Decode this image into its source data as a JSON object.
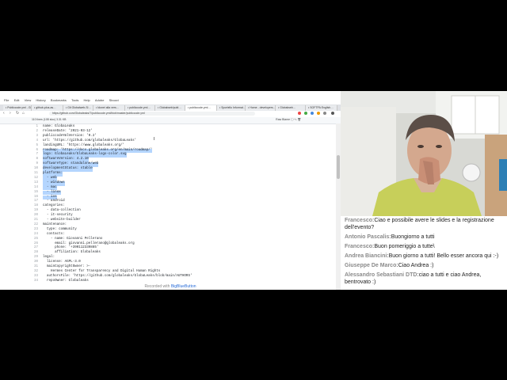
{
  "browser": {
    "menu": [
      "File",
      "Edit",
      "View",
      "History",
      "Bookmarks",
      "Tools",
      "Help",
      "Adobe",
      "Sbozzi"
    ],
    "tabs": [
      {
        "label": "• Publiccode.yml - Gi…",
        "active": false
      },
      {
        "label": "• github-plus-as…",
        "active": false
      },
      {
        "label": "• Git Globalweb-Si…",
        "active": false
      },
      {
        "label": "• Idonei alla vers…",
        "active": false
      },
      {
        "label": "• publiccode.yml…",
        "active": false
      },
      {
        "label": "• Globalweb/publ…",
        "active": false
      },
      {
        "label": "• publiccode.yml…",
        "active": true
      },
      {
        "label": "• Sportello Informat…",
        "active": false
      },
      {
        "label": "• Home - developers…",
        "active": false
      },
      {
        "label": "• Globalweb…",
        "active": false
      },
      {
        "label": "• SOFTPA English…",
        "active": false
      }
    ],
    "url": "https://github.com/GlobaleaksIT/publiccode.yml/blob/master/publiccode.yml",
    "file_info": "110 lines (108 sloc)   3.31 KB",
    "file_buttons": "Raw   Blame   🖵   ✎   🗑"
  },
  "code": [
    {
      "n": "1",
      "t": "name: GlobaLeaks"
    },
    {
      "n": "2",
      "t": "releaseDate: '2021-03-12'"
    },
    {
      "n": "3",
      "t": "publiccodeYmlVersion: '0.2'"
    },
    {
      "n": "4",
      "t": "url: 'https://github.com/globaleaks/GlobaLeaks'"
    },
    {
      "n": "5",
      "t": "landingURL: 'https://www.globaleaks.org/'"
    },
    {
      "n": "6",
      "t": "roadmap: 'https://docs.globaleaks.org/en/main/roadmap/'",
      "hl": true
    },
    {
      "n": "7",
      "t": "logo: GlobaLeaks/GlobaLeaks-logo-color.svg",
      "hl": true
    },
    {
      "n": "8",
      "t": "softwareVersion: 4.2.10",
      "hl": true
    },
    {
      "n": "9",
      "t": "softwareType: standalone/web",
      "hl": true
    },
    {
      "n": "10",
      "t": "developmentStatus: stable",
      "hl": true
    },
    {
      "n": "11",
      "t": "platforms:",
      "hl": true
    },
    {
      "n": "12",
      "t": "  - web",
      "hl": true
    },
    {
      "n": "13",
      "t": "  - windows",
      "hl": true
    },
    {
      "n": "14",
      "t": "  - mac",
      "hl": true
    },
    {
      "n": "15",
      "t": "  - linux",
      "hl": true
    },
    {
      "n": "16",
      "t": "  - ios",
      "hl": true
    },
    {
      "n": "17",
      "t": "  - android"
    },
    {
      "n": "18",
      "t": "categories:"
    },
    {
      "n": "19",
      "t": "  - data-collection"
    },
    {
      "n": "20",
      "t": "  - it-security"
    },
    {
      "n": "21",
      "t": "  - website-builder"
    },
    {
      "n": "22",
      "t": "maintenance:"
    },
    {
      "n": "23",
      "t": "  type: community"
    },
    {
      "n": "24",
      "t": "  contacts:"
    },
    {
      "n": "25",
      "t": "    - name: Giovanni Pellerano"
    },
    {
      "n": "26",
      "t": "      email: giovanni.pellerano@globaleaks.org"
    },
    {
      "n": "27",
      "t": "      phone: '+390112339885'"
    },
    {
      "n": "28",
      "t": "      affiliation: Globaleaks"
    },
    {
      "n": "29",
      "t": "legal:"
    },
    {
      "n": "30",
      "t": "  license: AGPL-3.0"
    },
    {
      "n": "31",
      "t": "  mainCopyrightOwner: >-"
    },
    {
      "n": "32",
      "t": "    Hermes Center for Transparency and Digital Human Rights"
    },
    {
      "n": "33",
      "t": "  authorsFile: 'https://github.com/globaleaks/GlobaLeaks/blob/main/AUTHORS'"
    },
    {
      "n": "34",
      "t": "  repoOwner: Globaleaks"
    }
  ],
  "recorded": {
    "prefix": "Recorded with",
    "brand": "BigBlueButton"
  },
  "chat": [
    {
      "name": "Francesco:",
      "text": "Ciao e possibile avere le slides e la registrazione dell'evento?"
    },
    {
      "name": "Antonio Pascalis:",
      "text": "Buongiorno a tutti"
    },
    {
      "name": "Francesco:",
      "text": "Buon pomeriggio a tutte\\"
    },
    {
      "name": "Andrea Biancini:",
      "text": "Buon giorno a tutti! Bello esser ancora qui :-)"
    },
    {
      "name": "Giuseppe De Marco:",
      "text": "Ciao Andrea :)"
    },
    {
      "name": "Alessandro Sebastiani DTD:",
      "text": "ciao a tutti e ciao Andrea, bentrovato :)"
    }
  ],
  "colors": {
    "link": "#2a6dd8",
    "selection": "#b4d5fe",
    "chat_name": "#8a8a8a"
  }
}
